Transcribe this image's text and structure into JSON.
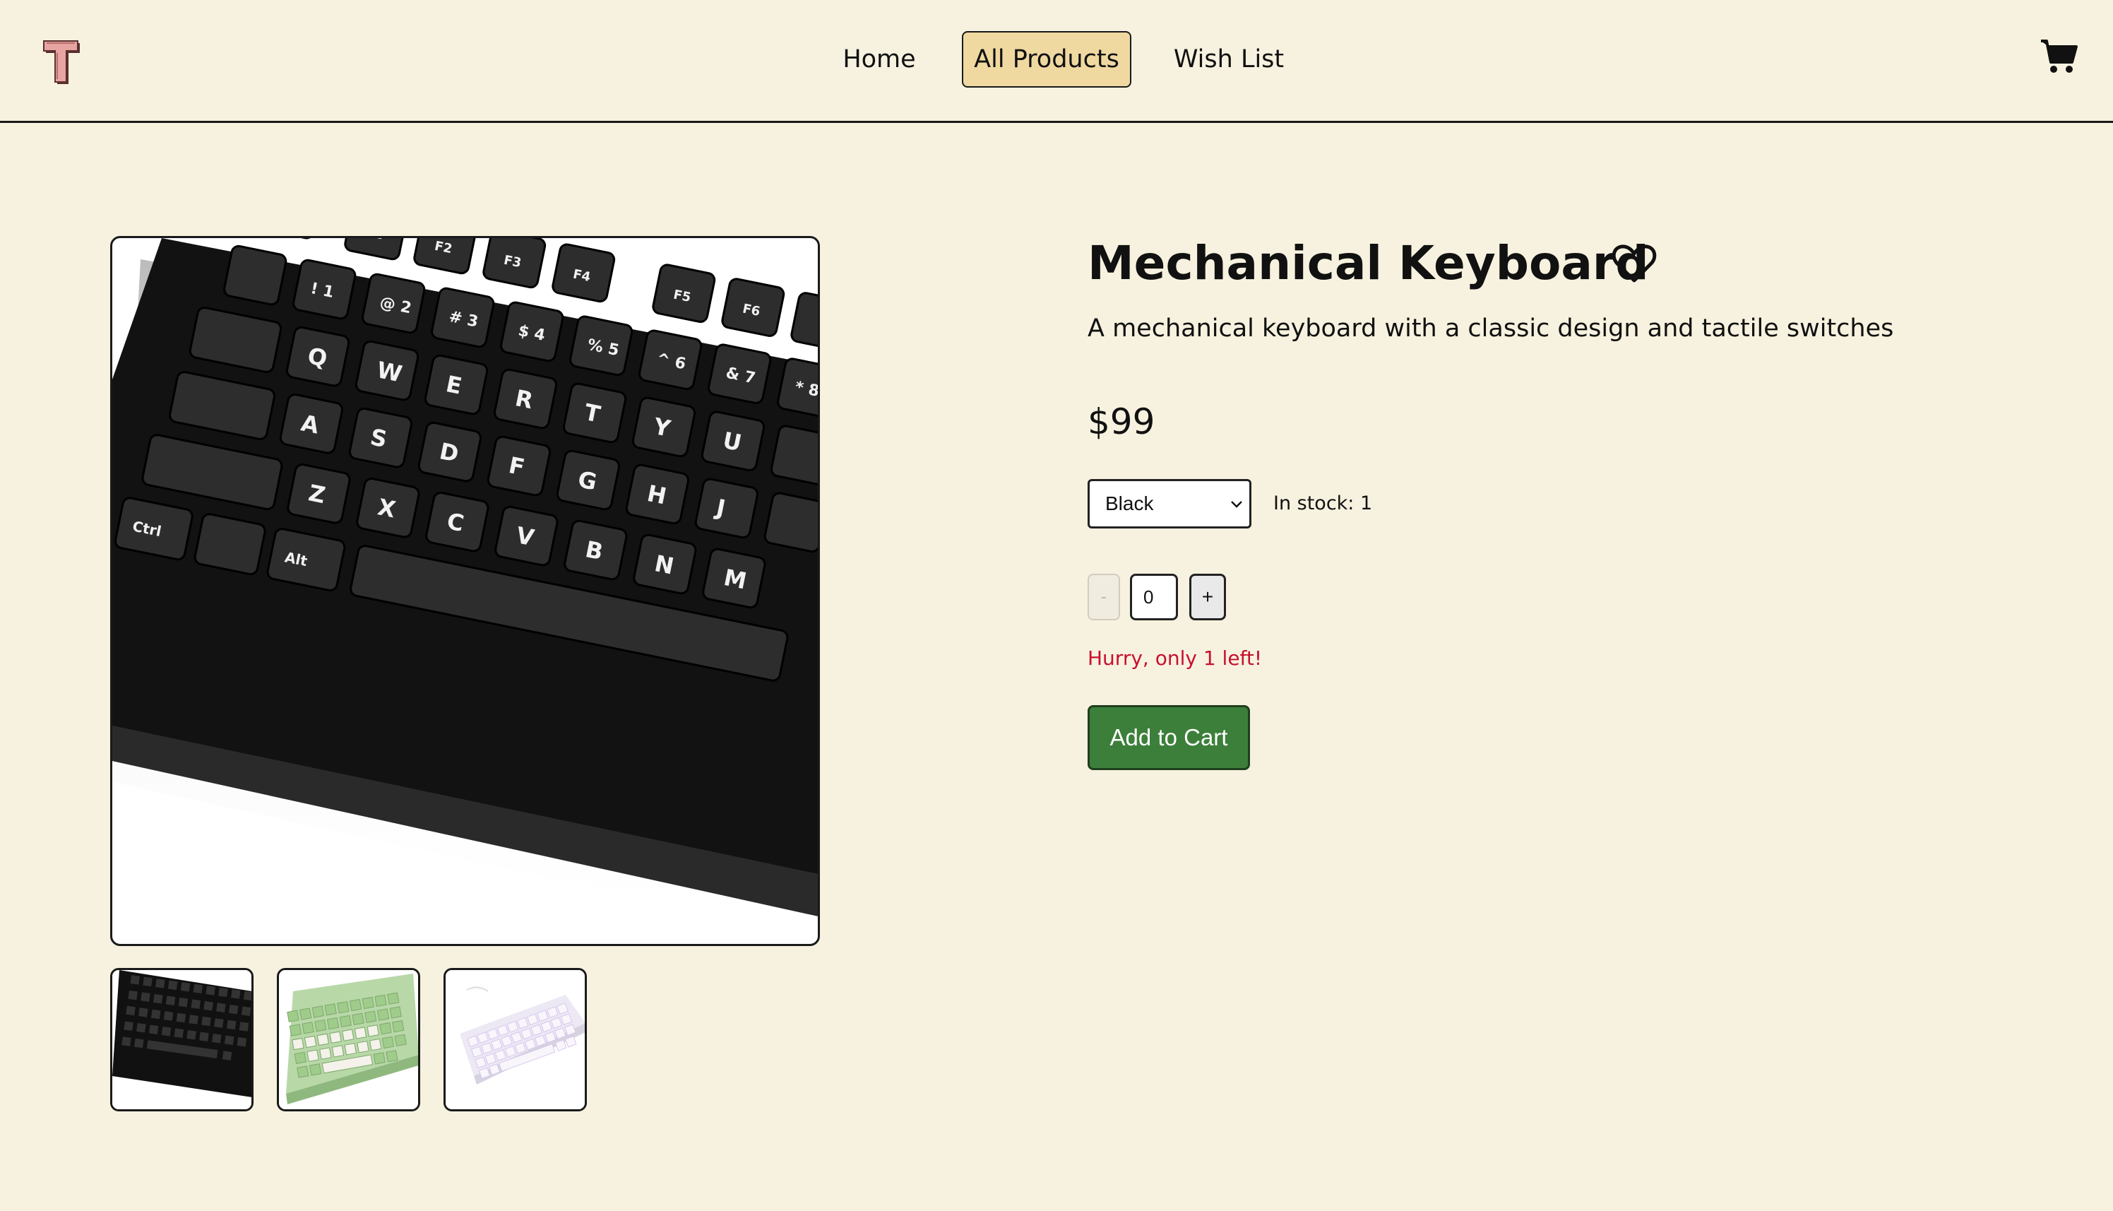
{
  "header": {
    "logo_letter": "T",
    "nav": {
      "home": "Home",
      "all_products": "All Products",
      "wish_list": "Wish List"
    },
    "active_nav": "All Products",
    "cart_icon": "cart-icon"
  },
  "product": {
    "title": "Mechanical Keyboard",
    "description": "A mechanical keyboard with a classic design and tactile switches",
    "price": "$99",
    "color_selected": "Black",
    "stock_text": "In stock: 1",
    "quantity": "0",
    "minus_label": "-",
    "plus_label": "+",
    "urgency": "Hurry, only 1 left!",
    "add_to_cart_label": "Add to Cart",
    "thumbnails": [
      "black-keyboard",
      "green-keyboard",
      "white-rgb-keyboard"
    ]
  },
  "colors": {
    "background": "#f7f2df",
    "active_nav_bg": "#efd9a0",
    "add_to_cart_bg": "#3c7f3a",
    "urgency_text": "#c8102e",
    "logo": "#e7a4a0"
  }
}
